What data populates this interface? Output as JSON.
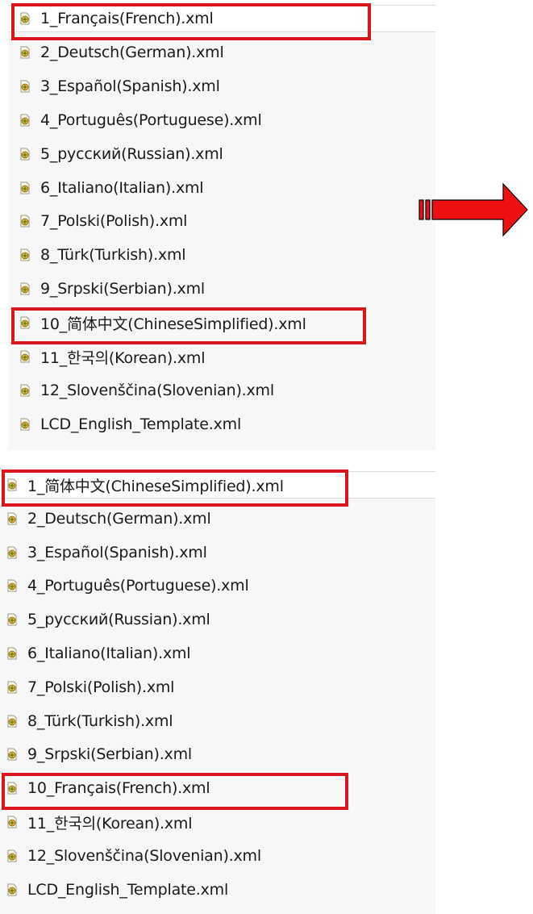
{
  "colors": {
    "highlight": "#d9151e",
    "arrow": "#ee1111",
    "panel": "#f7f7f7"
  },
  "icon": "xml-file-icon",
  "before": {
    "items": [
      "1_Français(French).xml",
      "2_Deutsch(German).xml",
      "3_Español(Spanish).xml",
      "4_Português(Portuguese).xml",
      "5_русский(Russian).xml",
      "6_Italiano(Italian).xml",
      "7_Polski(Polish).xml",
      "8_Türk(Turkish).xml",
      "9_Srpski(Serbian).xml",
      "10_简体中文(ChineseSimplified).xml",
      "11_한국의(Korean).xml",
      "12_Slovenščina(Slovenian).xml",
      "LCD_English_Template.xml"
    ],
    "highlighted": [
      0,
      9
    ]
  },
  "after": {
    "items": [
      "1_简体中文(ChineseSimplified).xml",
      "2_Deutsch(German).xml",
      "3_Español(Spanish).xml",
      "4_Português(Portuguese).xml",
      "5_русский(Russian).xml",
      "6_Italiano(Italian).xml",
      "7_Polski(Polish).xml",
      "8_Türk(Turkish).xml",
      "9_Srpski(Serbian).xml",
      "10_Français(French).xml",
      "11_한국의(Korean).xml",
      "12_Slovenščina(Slovenian).xml",
      "LCD_English_Template.xml"
    ],
    "highlighted": [
      0,
      9
    ]
  }
}
